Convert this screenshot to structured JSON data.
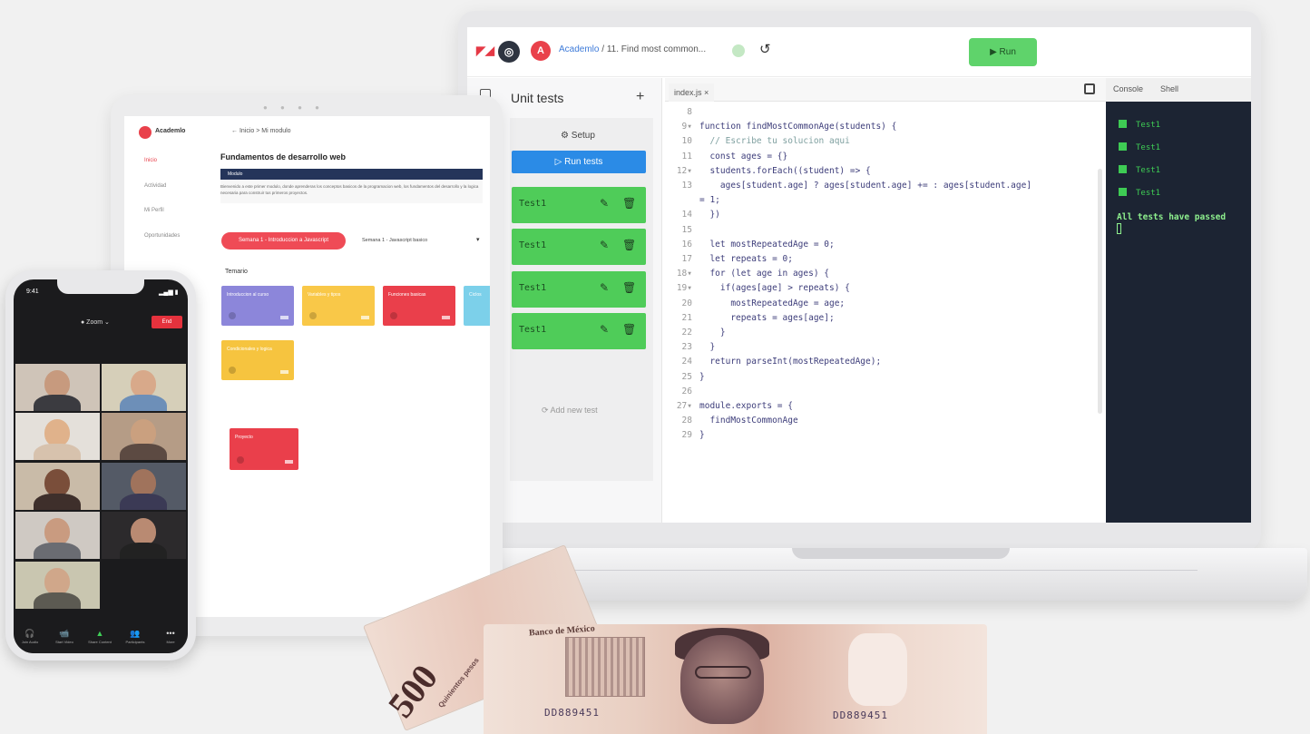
{
  "laptop": {
    "topbar": {
      "breadcrumb_link": "Academlo",
      "breadcrumb_sep": "/",
      "breadcrumb_item": "11. Find most common...",
      "run_label": "▶ Run"
    },
    "tests": {
      "title": "Unit tests",
      "plus": "+",
      "setup_label": "⚙ Setup",
      "run_tests_label": "▷ Run tests",
      "items": [
        "Test1",
        "Test1",
        "Test1",
        "Test1"
      ],
      "add_test_label": "⟳ Add new test"
    },
    "editor": {
      "tab": "index.js ×",
      "lines": [
        {
          "n": "8",
          "t": ""
        },
        {
          "n": "9▾",
          "t": "function findMostCommonAge(students) {"
        },
        {
          "n": "10",
          "t": "  // Escribe tu solucion aqui"
        },
        {
          "n": "11",
          "t": "  const ages = {}"
        },
        {
          "n": "12▾",
          "t": "  students.forEach((student) => {"
        },
        {
          "n": "13",
          "t": "    ages[student.age] ? ages[student.age] += : ages[student.age]"
        },
        {
          "n": "",
          "t": "= 1;"
        },
        {
          "n": "14",
          "t": "  })"
        },
        {
          "n": "15",
          "t": ""
        },
        {
          "n": "16",
          "t": "  let mostRepeatedAge = 0;"
        },
        {
          "n": "17",
          "t": "  let repeats = 0;"
        },
        {
          "n": "18▾",
          "t": "  for (let age in ages) {"
        },
        {
          "n": "19▾",
          "t": "    if(ages[age] > repeats) {"
        },
        {
          "n": "20",
          "t": "      mostRepeatedAge = age;"
        },
        {
          "n": "21",
          "t": "      repeats = ages[age];"
        },
        {
          "n": "22",
          "t": "    }"
        },
        {
          "n": "23",
          "t": "  }"
        },
        {
          "n": "24",
          "t": "  return parseInt(mostRepeatedAge);"
        },
        {
          "n": "25",
          "t": "}"
        },
        {
          "n": "26",
          "t": ""
        },
        {
          "n": "27▾",
          "t": "module.exports = {"
        },
        {
          "n": "28",
          "t": "  findMostCommonAge"
        },
        {
          "n": "29",
          "t": "}"
        }
      ]
    },
    "console": {
      "tab_console": "Console",
      "tab_shell": "Shell",
      "results": [
        "Test1",
        "Test1",
        "Test1",
        "Test1"
      ],
      "passed_msg": "All tests have passed"
    }
  },
  "tablet": {
    "brand": "Academlo",
    "back": "←  Inicio  >  Mi modulo",
    "nav": [
      "Inicio",
      "Actividad",
      "Mi Perfil",
      "Oportunidades"
    ],
    "title": "Fundamentos de desarrollo web",
    "band": "Modulo",
    "desc": "Bienvenido a este primer modulo, donde aprenderas los conceptos basicos de la programacion web, los fundamentos del desarrollo y la logica necesaria para construir tus primeros proyectos.",
    "pill": "Semana 1 - Introduccion a Javascript",
    "select_label": "Semana 1 - Javascript basico",
    "arrow": "▾",
    "temas_label": "Temario",
    "cards": [
      {
        "label": "Introduccion al curso",
        "color": "#8c86da"
      },
      {
        "label": "Variables y tipos",
        "color": "#f9c848"
      },
      {
        "label": "Funciones basicas",
        "color": "#ea3f4b"
      },
      {
        "label": "Ciclos",
        "color": "#7cd0ea"
      },
      {
        "label": "Condicionales y logica",
        "color": "#f6c43f"
      },
      {
        "label": "Proyecto",
        "color": "#ea3f4b"
      }
    ]
  },
  "phone": {
    "time": "9:41",
    "status": "▂▄▆ ▮",
    "meeting": "● Zoom ⌄",
    "end_label": "End",
    "toolbar": [
      {
        "icon": "🎧",
        "label": "Join Audio"
      },
      {
        "icon": "📹",
        "label": "Start Video"
      },
      {
        "icon": "▲",
        "label": "Share Content"
      },
      {
        "icon": "👥",
        "label": "Participants"
      },
      {
        "icon": "•••",
        "label": "More"
      }
    ]
  },
  "banknote": {
    "title": "Banco de México",
    "denomination": "500",
    "denomination_word": "Quinientos pesos",
    "serial1": "DD889451",
    "serial2": "DD889451"
  }
}
